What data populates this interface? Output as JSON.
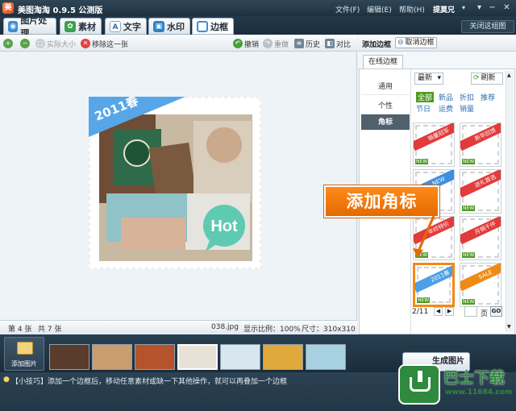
{
  "app": {
    "title": "美图淘淘 0.9.5 公测版",
    "user": "提莫兄"
  },
  "menu": [
    "文件(F)",
    "编辑(E)",
    "帮助(H)"
  ],
  "tabs": [
    {
      "label": "图片处理",
      "icon": "picture-icon"
    },
    {
      "label": "素材",
      "icon": "material-icon"
    },
    {
      "label": "文字",
      "icon": "text-icon"
    },
    {
      "label": "水印",
      "icon": "watermark-icon"
    },
    {
      "label": "边框",
      "icon": "frame-icon",
      "active": true
    }
  ],
  "close_image": "关闭这组图",
  "toolbar": {
    "actual_size": "实际大小",
    "remove_one": "移除这一张",
    "undo": "撤销",
    "redo": "重做",
    "history": "历史",
    "compare": "对比"
  },
  "canvas": {
    "year_text": "2011春",
    "hot_text": "Hot"
  },
  "status": {
    "current": "第 4 张",
    "total": "共 7 张",
    "filename": "038.jpg",
    "ratio": "显示比例：100%",
    "size": "尺寸：310x310"
  },
  "panel": {
    "title": "添加边框",
    "cancel": "取消边框",
    "online_tab": "在线边框",
    "categories": [
      "通用",
      "个性",
      "角标"
    ],
    "selected_category": "角标",
    "sort": "最新",
    "refresh": "刷新",
    "filters": [
      "全部",
      "新品",
      "折扣",
      "推荐",
      "节日",
      "运费",
      "销量"
    ],
    "selected_filter": "全部",
    "thumbs": [
      {
        "label": "销量冠军",
        "color": "#e23b3b"
      },
      {
        "label": "新年回馈",
        "color": "#e23b3b"
      },
      {
        "label": "NEW",
        "color": "#3c8fe0"
      },
      {
        "label": "送礼首选",
        "color": "#e23b3b"
      },
      {
        "label": "年终特价",
        "color": "#e23b3b"
      },
      {
        "label": "月销千件",
        "color": "#e23b3b"
      },
      {
        "label": "2011春",
        "color": "#4f9fe5"
      },
      {
        "label": "SALE",
        "color": "#f08a16"
      }
    ],
    "new_badge": "NEW",
    "pager": "2/11",
    "page_unit": "页",
    "go": "GO"
  },
  "strip": {
    "add_label": "添加图片",
    "generate": "生成图片",
    "thumb_count": 7
  },
  "tip": "【小技巧】添加一个边框后，移动任意素材或缺一下其他操作，就可以再叠加一个边框",
  "callout": "添加角标",
  "watermark": {
    "brand": "巴士下载",
    "url": "www.11684.com"
  },
  "colors": {
    "accent": "#e46a00",
    "titlebar": "#1e3140",
    "green": "#4f9a22"
  }
}
